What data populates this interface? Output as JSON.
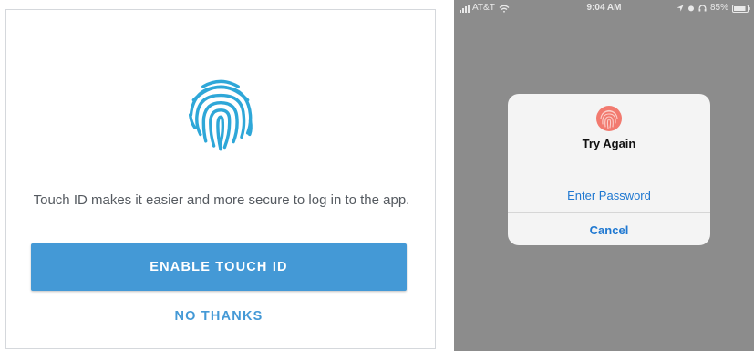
{
  "left_screen": {
    "icon": "fingerprint-icon",
    "message": "Touch ID makes it easier and more secure to log in to the app.",
    "enable_button_label": "ENABLE TOUCH ID",
    "no_thanks_label": "NO THANKS",
    "colors": {
      "accent": "#4499d6",
      "text": "#555a60"
    }
  },
  "right_screen": {
    "status_bar": {
      "carrier": "AT&T",
      "time": "9:04 AM",
      "battery": "85%",
      "icons": [
        "signal-icon",
        "wifi-icon",
        "location-icon",
        "alarm-icon",
        "headphones-icon",
        "battery-icon"
      ]
    },
    "dialog": {
      "icon": "fingerprint-icon",
      "title": "Try Again",
      "actions": [
        {
          "label": "Enter Password"
        },
        {
          "label": "Cancel"
        }
      ]
    },
    "colors": {
      "background": "#8c8c8c",
      "action": "#1f78d1",
      "fingerprint": "#f06c62"
    }
  }
}
